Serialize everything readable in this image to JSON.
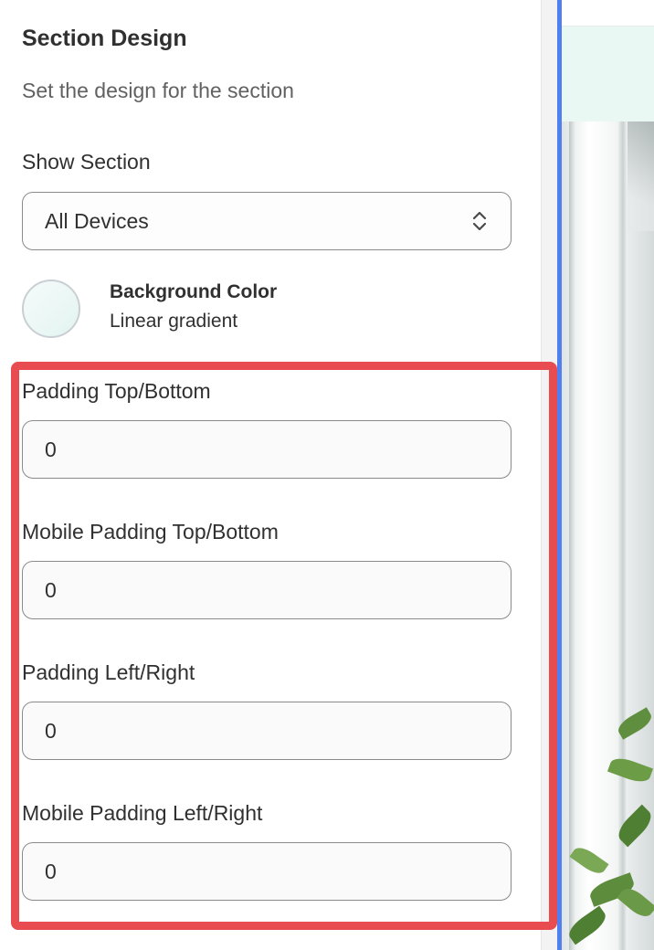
{
  "panel": {
    "title": "Section Design",
    "subtitle": "Set the design for the section",
    "show_section": {
      "label": "Show Section",
      "selected": "All Devices"
    },
    "background": {
      "label": "Background Color",
      "value": "Linear gradient",
      "swatch_colors": [
        "#f6fbfb",
        "#e2f4f1"
      ]
    },
    "padding_fields": [
      {
        "label": "Padding Top/Bottom",
        "value": "0"
      },
      {
        "label": "Mobile Padding Top/Bottom",
        "value": "0"
      },
      {
        "label": "Padding Left/Right",
        "value": "0"
      },
      {
        "label": "Mobile Padding Left/Right",
        "value": "0"
      }
    ]
  },
  "colors": {
    "highlight": "#e84c50",
    "preview_accent": "#4f7ff0",
    "preview_band": "#eaf8f4"
  }
}
